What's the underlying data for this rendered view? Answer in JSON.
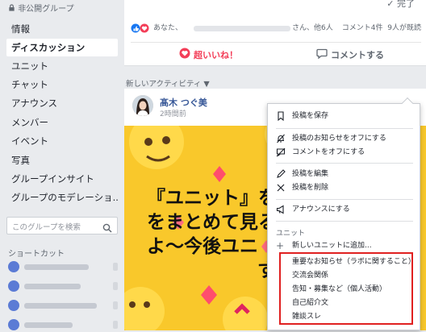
{
  "sidebar": {
    "group_privacy": "非公開グループ",
    "nav": [
      "情報",
      "ディスカッション",
      "ユニット",
      "チャット",
      "アナウンス",
      "メンバー",
      "イベント",
      "写真",
      "グループインサイト",
      "グループのモデレーショ..."
    ],
    "active_index": 1,
    "search_placeholder": "このグループを検索",
    "shortcuts_title": "ショートカット"
  },
  "post": {
    "done_label": "完了",
    "reaction_text_a": "あなた、",
    "reaction_text_b": "さん、他6人",
    "comment_count": "コメント4件",
    "seen": "9人が既読",
    "like_label": "超いいね！",
    "comment_label": "コメントする"
  },
  "activity_label": "新しいアクティビティ ▼",
  "post2": {
    "author": "髙木 つぐ美",
    "time": "2時間前",
    "image_lines": [
      "『ユニット』を",
      "をまとめて見る",
      "よ〜今後ユニ",
      "す"
    ]
  },
  "menu": {
    "items": [
      {
        "label": "投稿を保存",
        "icon": "bookmark-icon"
      },
      {
        "label": "投稿のお知らせをオフにする",
        "icon": "bell-off-icon"
      },
      {
        "label": "コメントをオフにする",
        "icon": "comment-off-icon"
      },
      {
        "label": "投稿を編集",
        "icon": "pencil-icon"
      },
      {
        "label": "投稿を削除",
        "icon": "close-icon"
      },
      {
        "label": "アナウンスにする",
        "icon": "megaphone-icon"
      }
    ],
    "unit_section": "ユニット",
    "add_unit": "新しいユニットに追加...",
    "units": [
      "重要なお知らせ（ラボに関すること）",
      "交流会関係",
      "告知・募集など（個人活動）",
      "自己紹介文",
      "雑談スレ"
    ]
  },
  "colors": {
    "accent_blue": "#385898",
    "love_red": "#f33e58",
    "highlight_red": "#e02020",
    "image_yellow": "#f9c82b"
  }
}
